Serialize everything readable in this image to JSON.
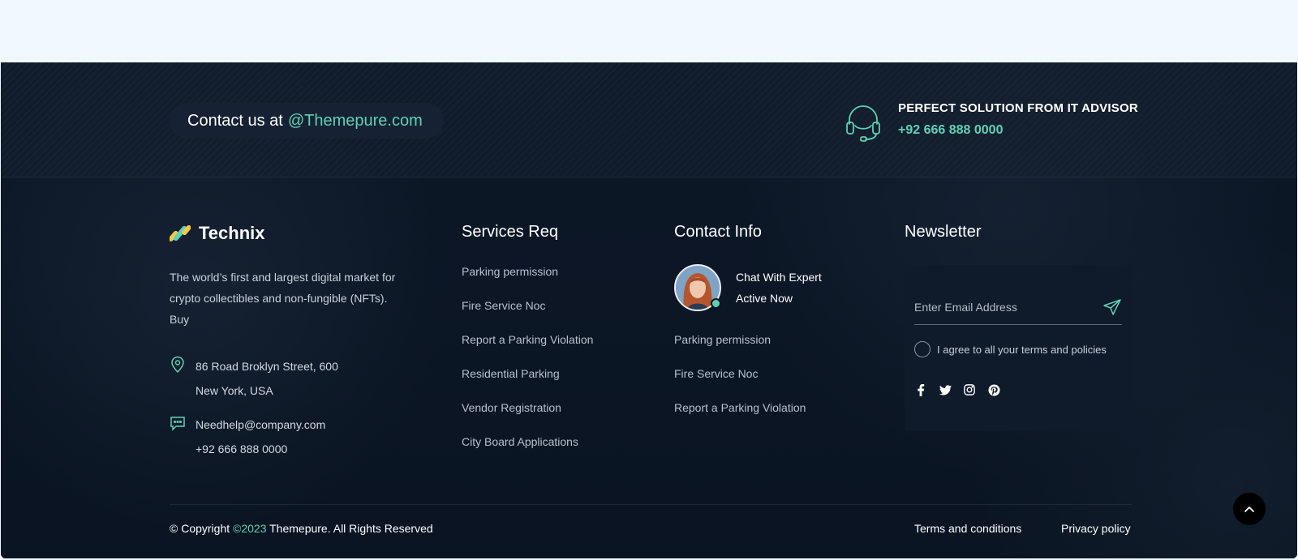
{
  "top_bar": {
    "contact_prefix": "Contact us at",
    "contact_email": "@Themepure.com",
    "advisor_title": "PERFECT SOLUTION FROM IT ADVISOR",
    "advisor_phone": "+92 666 888 0000",
    "headset_icon": "headset-icon"
  },
  "brand": {
    "logo_icon": "technix-logo-mark",
    "name": "Technix",
    "about": "The world’s first and largest digital market for crypto collectibles and non-fungible (NFTs). Buy",
    "address_icon": "map-pin-icon",
    "address_line1": "86 Road Broklyn Street, 600",
    "address_line2": "New York, USA",
    "contact_icon": "chat-icon",
    "email": "Needhelp@company.com",
    "phone": "+92 666 888 0000"
  },
  "services": {
    "title": "Services Req",
    "items": [
      "Parking permission",
      "Fire Service Noc",
      "Report a Parking Violation",
      "Residential Parking",
      "Vendor Registration",
      "City Board Applications"
    ]
  },
  "contact_info": {
    "title": "Contact Info",
    "expert_line1": "Chat With Expert",
    "expert_line2": "Active Now",
    "items": [
      "Parking permission",
      "Fire Service Noc",
      "Report a Parking Violation"
    ]
  },
  "newsletter": {
    "title": "Newsletter",
    "email_placeholder": "Enter Email Address",
    "agree_label": "I agree to all your terms and policies",
    "send_icon": "paper-plane-icon",
    "socials": [
      "facebook-icon",
      "twitter-icon",
      "instagram-icon",
      "pinterest-icon"
    ]
  },
  "bottom": {
    "copyright_prefix": "© Copyright",
    "copyright_year": "©2023",
    "copyright_suffix": "Themepure. All Rights Reserved",
    "terms": "Terms and conditions",
    "privacy": "Privacy policy",
    "scroll_top_icon": "chevron-up-icon"
  },
  "colors": {
    "accent": "#5fd1b3",
    "footer_bg": "#0b1524",
    "page_bg": "#f1f8fe"
  }
}
